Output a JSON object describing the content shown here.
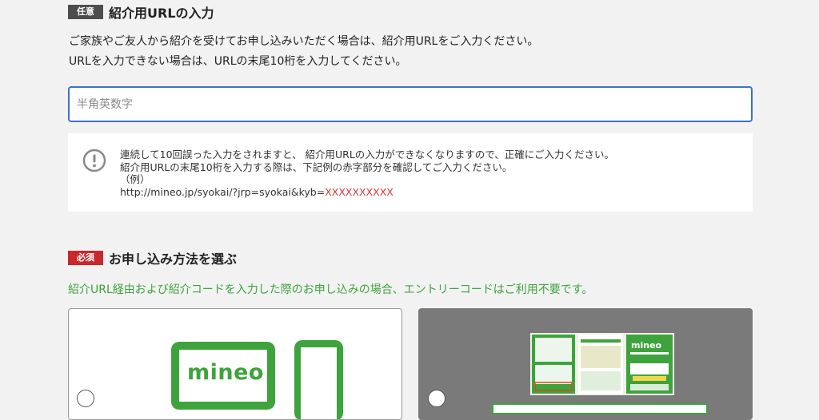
{
  "referral": {
    "badge": "任意",
    "title": "紹介用URLの入力",
    "desc_line1": "ご家族やご友人から紹介を受けてお申し込みいただく場合は、紹介用URLをご入力ください。",
    "desc_line2": "URLを入力できない場合は、URLの末尾10桁を入力してください。",
    "input_placeholder": "半角英数字",
    "input_value": "",
    "note_line1": "連続して10回誤った入力をされますと、 紹介用URLの入力ができなくなりますので、正確にご入力ください。",
    "note_line2": "紹介用URLの末尾10桁を入力する際は、下記例の赤字部分を確認してご入力ください。",
    "note_example_label": "（例）",
    "example_url_prefix": "http://mineo.jp/syokai/?jrp=syokai&kyb=",
    "example_url_code": "XXXXXXXXXX"
  },
  "method": {
    "badge": "必須",
    "title": "お申し込み方法を選ぶ",
    "notice": "紹介URL経由および紹介コードを入力した際のお申し込みの場合、エントリーコードはご利用不要です。",
    "options": [
      {
        "label": "online",
        "logo_text": "mineo"
      },
      {
        "label": "entry-package",
        "logo_text": "mineo"
      }
    ]
  },
  "colors": {
    "accent_blue": "#3a73c9",
    "mineo_green": "#3ea33c",
    "required_red": "#c8282d",
    "optional_gray": "#4d4d4d"
  }
}
